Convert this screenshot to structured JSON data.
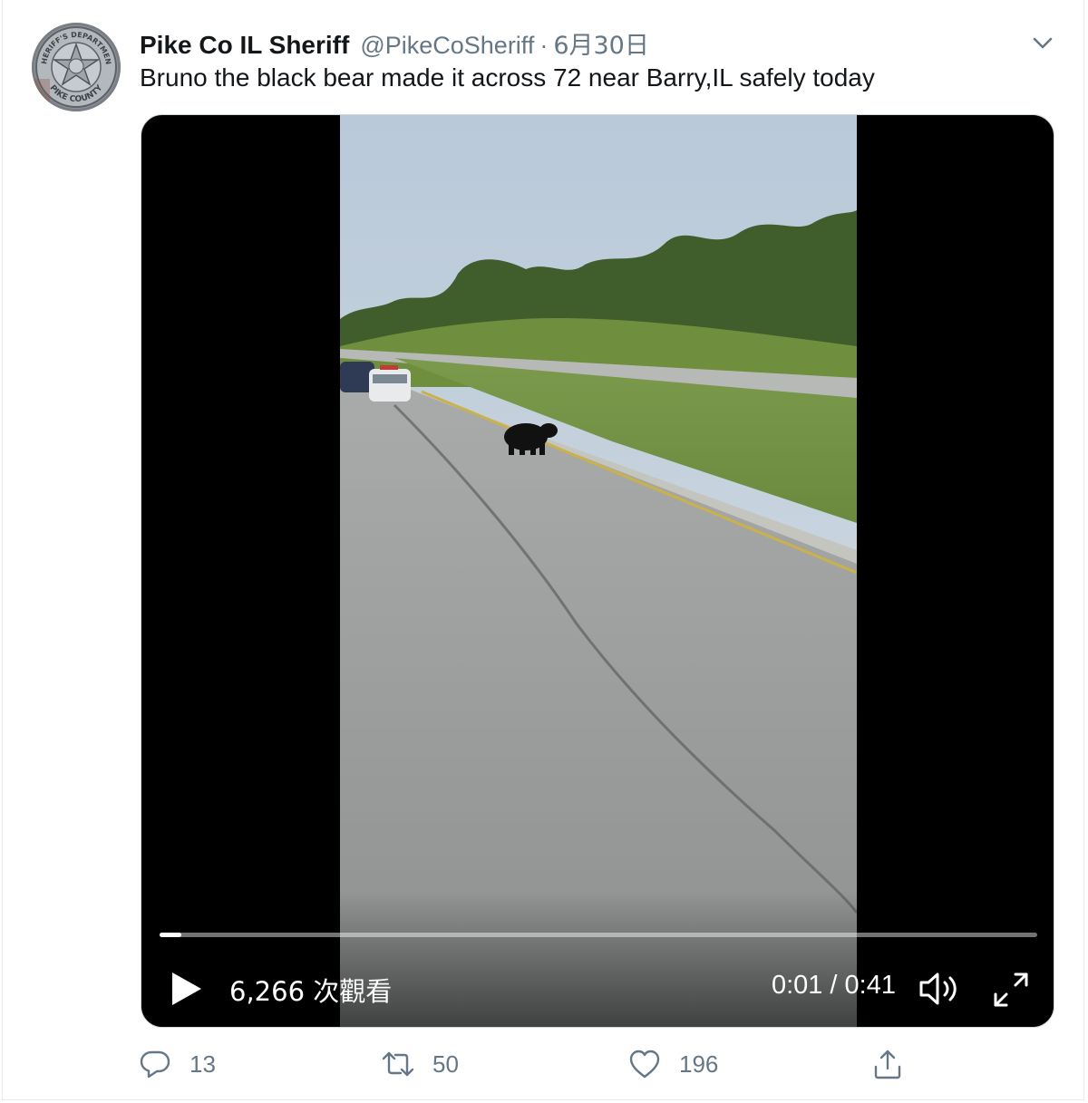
{
  "tweet": {
    "author_name": "Pike Co IL Sheriff",
    "handle": "@PikeCoSheriff",
    "separator": "·",
    "date": "6月30日",
    "text": "Bruno the black bear made it across 72 near Barry,IL safely today",
    "avatar_text": {
      "top": "SHERIFF'S DEPARTMENT",
      "bottom": "PIKE COUNTY"
    }
  },
  "video": {
    "views": "6,266 次觀看",
    "time": "0:01 / 0:41",
    "progress_percent": 2.5
  },
  "actions": {
    "reply_count": "13",
    "retweet_count": "50",
    "like_count": "196"
  },
  "colors": {
    "text": "#14171a",
    "secondary": "#657786",
    "border": "#e6ecf0"
  },
  "icons": {
    "menu": "chevron-down-icon",
    "reply": "reply-icon",
    "retweet": "retweet-icon",
    "like": "heart-icon",
    "share": "share-icon",
    "play": "play-icon",
    "volume": "volume-icon",
    "fullscreen": "fullscreen-icon"
  }
}
